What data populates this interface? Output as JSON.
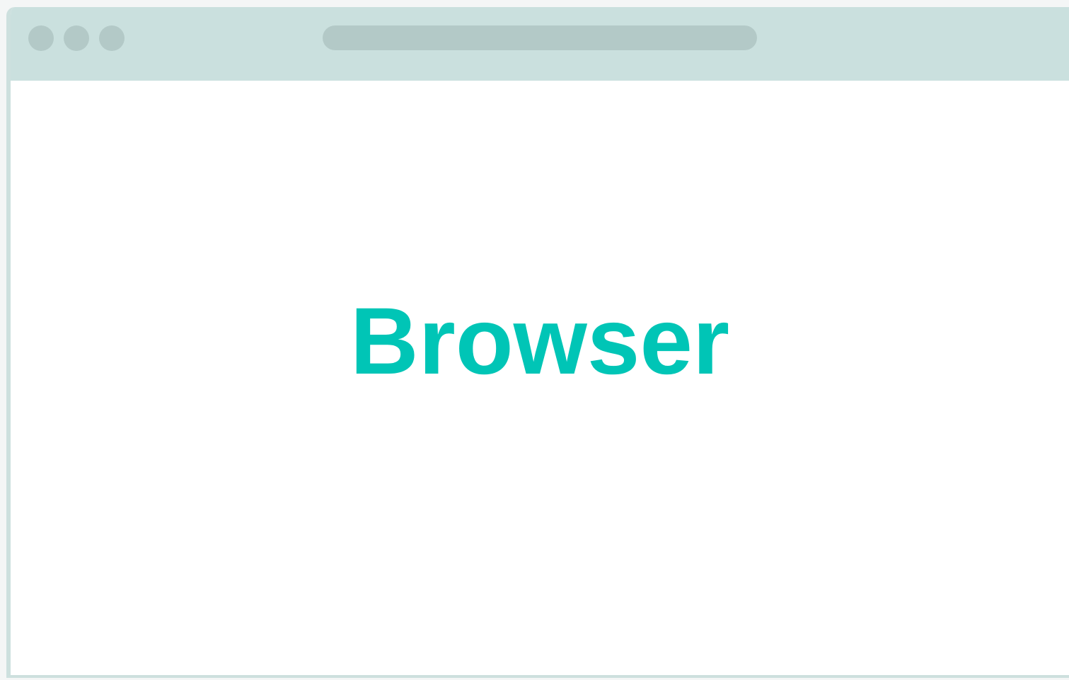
{
  "window": {
    "heading": "Browser",
    "colors": {
      "chrome": "#cae0de",
      "chrome_elements": "#b3c9c7",
      "accent_text": "#00c5b6",
      "content_background": "#ffffff"
    },
    "controls": [
      {
        "icon": "window-control-dot-icon"
      },
      {
        "icon": "window-control-dot-icon"
      },
      {
        "icon": "window-control-dot-icon"
      }
    ]
  }
}
